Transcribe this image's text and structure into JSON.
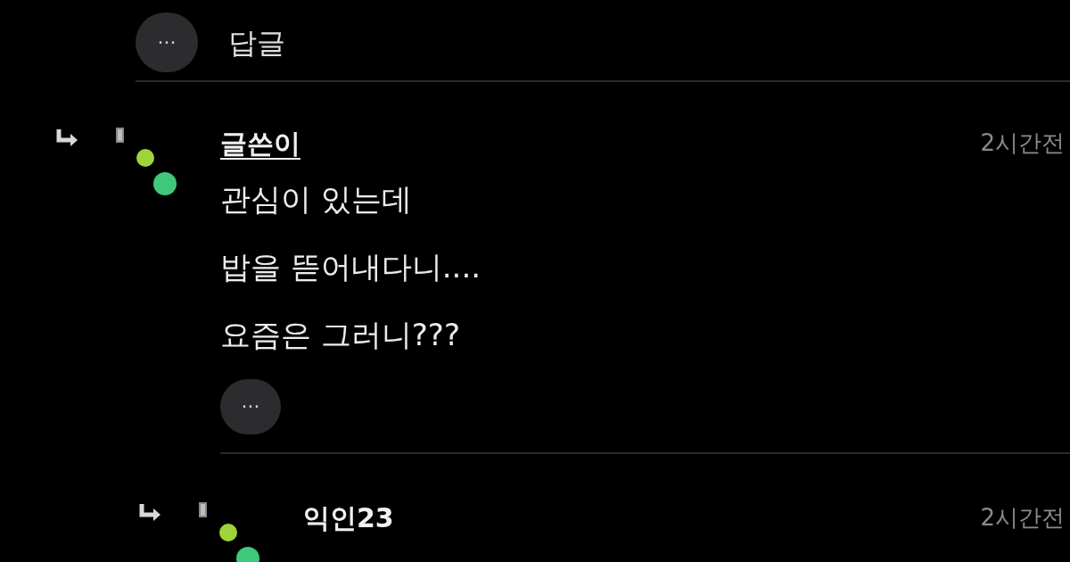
{
  "top_actions": {
    "more_label": "···",
    "reply_label": "답글"
  },
  "comments": [
    {
      "author": "글쓴이",
      "is_writer": true,
      "time": "2시간전",
      "lines": [
        "관심이 있는데",
        "밥을 뜯어내다니....",
        "요즘은 그러니???"
      ],
      "more_label": "···",
      "children": [
        {
          "author": "익인23",
          "is_writer": false,
          "time": "2시간전"
        }
      ]
    }
  ]
}
